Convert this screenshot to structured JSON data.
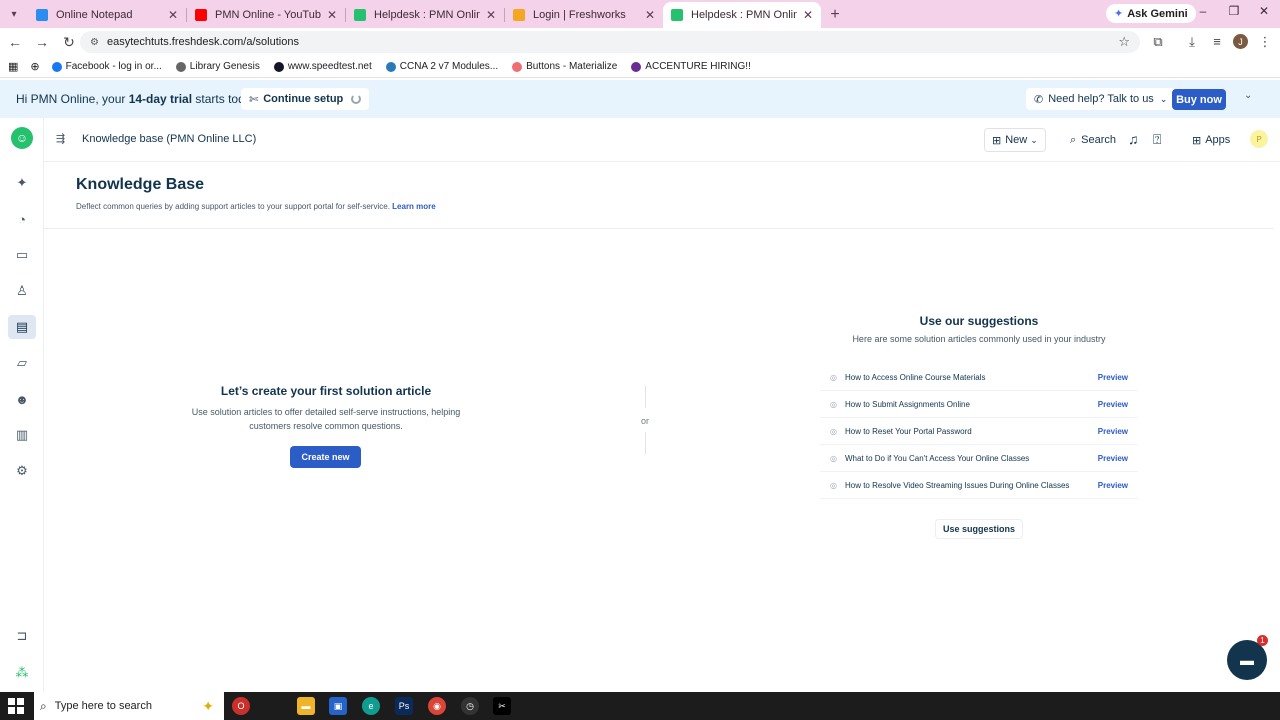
{
  "browser": {
    "tabs": [
      {
        "title": "Online Notepad",
        "color": "#2d8cf0",
        "active": false
      },
      {
        "title": "PMN Online - YouTube",
        "color": "#ff0000",
        "active": false
      },
      {
        "title": "Helpdesk : PMN Online LLC",
        "color": "#25c16f",
        "active": false
      },
      {
        "title": "Login | Freshworks",
        "color": "#f5a623",
        "active": false
      },
      {
        "title": "Helpdesk : PMN Online LLC",
        "color": "#25c16f",
        "active": true
      }
    ],
    "gemini_label": "Ask Gemini",
    "url": "easytechtuts.freshdesk.com/a/solutions",
    "profile_initial": "J",
    "bookmarks": [
      {
        "label": "Facebook - log in or...",
        "color": "#1877f2"
      },
      {
        "label": "Library Genesis",
        "color": "#666666"
      },
      {
        "label": "www.speedtest.net",
        "color": "#141526"
      },
      {
        "label": "CCNA 2 v7 Modules...",
        "color": "#2a7ab8"
      },
      {
        "label": "Buttons - Materialize",
        "color": "#ee6e73"
      },
      {
        "label": "ACCENTURE HIRING!!",
        "color": "#6a2c91"
      }
    ]
  },
  "banner": {
    "greeting_prefix": "Hi PMN Online, your ",
    "greeting_bold": "14-day trial",
    "greeting_suffix": " starts today.",
    "continue_setup": "Continue setup",
    "need_help": "Need help? Talk to us",
    "buy_now": "Buy now"
  },
  "header": {
    "kb_title": "Knowledge base (PMN Online LLC)",
    "new_label": "New",
    "search_label": "Search",
    "apps_label": "Apps",
    "avatar_initial": "P"
  },
  "main": {
    "title": "Knowledge Base",
    "subtitle": "Deflect common queries by adding support articles to your support portal for self-service.",
    "learn_more": "Learn more",
    "create_title": "Let’s create your first solution article",
    "create_desc": "Use solution articles to offer detailed self-serve instructions, helping customers resolve common questions.",
    "create_button": "Create new",
    "or_label": "or",
    "suggestions_title": "Use our suggestions",
    "suggestions_sub": "Here are some solution articles commonly used in your industry",
    "preview_label": "Preview",
    "suggestions": [
      "How to Access Online Course Materials",
      "How to Submit Assignments Online",
      "How to Reset Your Portal Password",
      "What to Do if You Can't Access Your Online Classes",
      "How to Resolve Video Streaming Issues During Online Classes"
    ],
    "use_suggestions": "Use suggestions",
    "chat_badge": "1"
  },
  "taskbar": {
    "search_placeholder": "Type here to search"
  },
  "colors": {
    "accent": "#2c5cc5",
    "brand_green": "#25c16f",
    "tabstrip": "#f4d3ea",
    "banner": "#e8f4fd"
  }
}
